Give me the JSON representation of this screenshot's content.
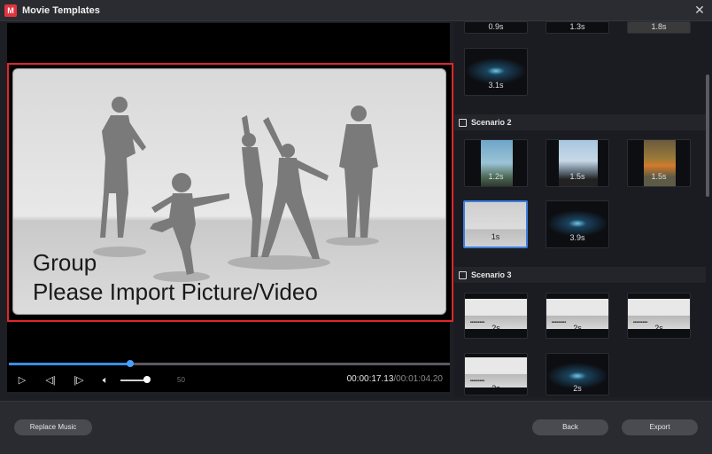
{
  "window": {
    "title": "Movie Templates",
    "app_icon": "M"
  },
  "player": {
    "card_title": "Group",
    "card_subtitle": "Please Import Picture/Video",
    "progress_fraction": 0.275,
    "volume_value": "50",
    "time_current": "00:00:17.13",
    "time_total": "/00:01:04.20"
  },
  "panel": {
    "top_thumbs": [
      "0.9s",
      "1.3s",
      "1.8s"
    ],
    "thumb_3_1": "3.1s",
    "scenario2": {
      "label": "Scenario 2",
      "thumbs": [
        "1.2s",
        "1.5s",
        "1.5s",
        "1s",
        "3.9s"
      ]
    },
    "scenario3": {
      "label": "Scenario 3",
      "thumbs": [
        "2s",
        "2s",
        "2s",
        "2s",
        "2s"
      ]
    }
  },
  "buttons": {
    "replace_music": "Replace Music",
    "back": "Back",
    "export": "Export"
  },
  "colors": {
    "accent": "#3a8ee6",
    "selection": "#e0262b",
    "background": "#1e1f24"
  }
}
